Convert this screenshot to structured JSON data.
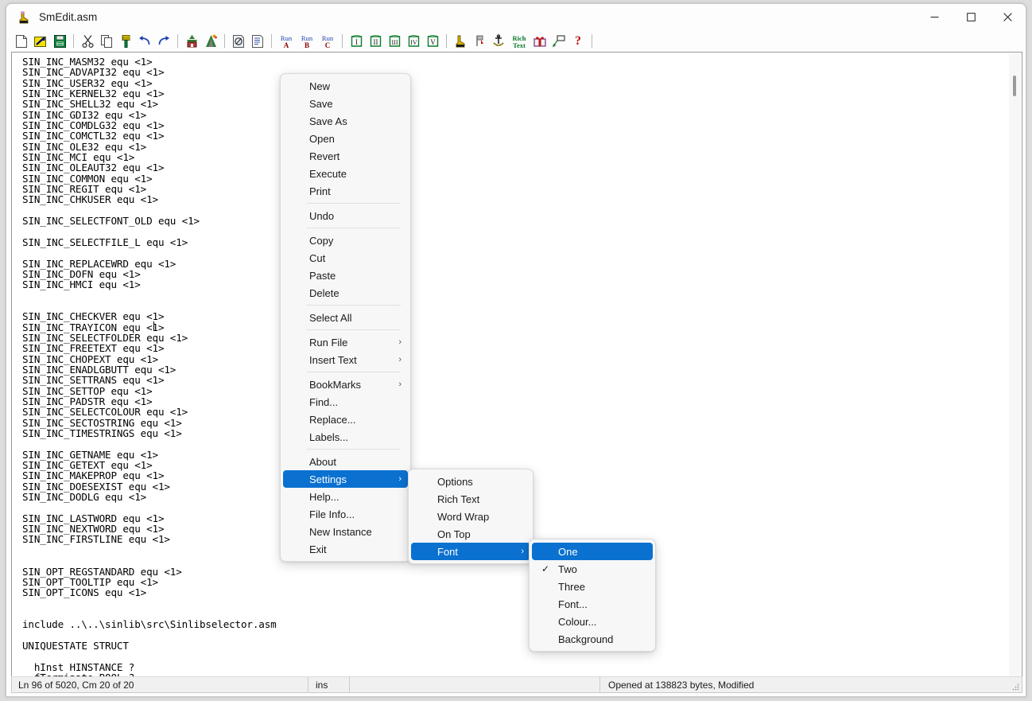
{
  "window": {
    "title": "SmEdit.asm",
    "icon": "boot-icon",
    "controls": {
      "minimize": "–",
      "maximize": "☐",
      "close": "×"
    }
  },
  "toolbar": {
    "groups": [
      [
        {
          "name": "new-file-icon",
          "label": "New"
        },
        {
          "name": "open-file-icon",
          "label": "Open"
        },
        {
          "name": "save-file-icon",
          "label": "Save"
        }
      ],
      [
        {
          "name": "cut-icon",
          "label": "Cut"
        },
        {
          "name": "copy-icon",
          "label": "Copy"
        },
        {
          "name": "paste-icon",
          "label": "Paste"
        },
        {
          "name": "undo-icon",
          "label": "Undo"
        },
        {
          "name": "redo-icon",
          "label": "Redo"
        }
      ],
      [
        {
          "name": "build-icon",
          "label": "Build"
        },
        {
          "name": "assemble-icon",
          "label": "Assemble"
        }
      ],
      [
        {
          "name": "preview-icon",
          "label": "Preview"
        },
        {
          "name": "document-icon",
          "label": "Document"
        }
      ],
      [
        {
          "name": "run-a-icon",
          "label": "Run A"
        },
        {
          "name": "run-b-icon",
          "label": "Run B"
        },
        {
          "name": "run-c-icon",
          "label": "Run C"
        }
      ],
      [
        {
          "name": "bookmark-1-icon",
          "label": "Bookmark I"
        },
        {
          "name": "bookmark-2-icon",
          "label": "Bookmark II"
        },
        {
          "name": "bookmark-3-icon",
          "label": "Bookmark III"
        },
        {
          "name": "bookmark-4-icon",
          "label": "Bookmark IV"
        },
        {
          "name": "bookmark-5-icon",
          "label": "Bookmark V"
        }
      ],
      [
        {
          "name": "boot-icon",
          "label": "Boot"
        },
        {
          "name": "flag-icon",
          "label": "Flag"
        },
        {
          "name": "anchor-icon",
          "label": "Anchor"
        },
        {
          "name": "rich-text-icon",
          "label": "Rich Text"
        },
        {
          "name": "gift-icon",
          "label": "Gift"
        },
        {
          "name": "select-icon",
          "label": "Select"
        },
        {
          "name": "help-icon",
          "label": "Help"
        }
      ]
    ]
  },
  "editor": {
    "content": "SIN_INC_MASM32 equ <1>\nSIN_INC_ADVAPI32 equ <1>\nSIN_INC_USER32 equ <1>\nSIN_INC_KERNEL32 equ <1>\nSIN_INC_SHELL32 equ <1>\nSIN_INC_GDI32 equ <1>\nSIN_INC_COMDLG32 equ <1>\nSIN_INC_COMCTL32 equ <1>\nSIN_INC_OLE32 equ <1>\nSIN_INC_MCI equ <1>\nSIN_INC_OLEAUT32 equ <1>\nSIN_INC_COMMON equ <1>\nSIN_INC_REGIT equ <1>\nSIN_INC_CHKUSER equ <1>\n\nSIN_INC_SELECTFONT_OLD equ <1>\n\nSIN_INC_SELECTFILE_L equ <1>\n\nSIN_INC_REPLACEWRD equ <1>\nSIN_INC_DOFN equ <1>\nSIN_INC_HMCI equ <1>\n\n\nSIN_INC_CHECKVER equ <1>\nSIN_INC_TRAYICON equ <1>\nSIN_INC_SELECTFOLDER equ <1>\nSIN_INC_FREETEXT equ <1>\nSIN_INC_CHOPEXT equ <1>\nSIN_INC_ENADLGBUTT equ <1>\nSIN_INC_SETTRANS equ <1>\nSIN_INC_SETTOP equ <1>\nSIN_INC_PADSTR equ <1>\nSIN_INC_SELECTCOLOUR equ <1>\nSIN_INC_SECTOSTRING equ <1>\nSIN_INC_TIMESTRINGS equ <1>\n\nSIN_INC_GETNAME equ <1>\nSIN_INC_GETEXT equ <1>\nSIN_INC_MAKEPROP equ <1>\nSIN_INC_DOESEXIST equ <1>\nSIN_INC_DODLG equ <1>\n\nSIN_INC_LASTWORD equ <1>\nSIN_INC_NEXTWORD equ <1>\nSIN_INC_FIRSTLINE equ <1>\n\n\nSIN_OPT_REGSTANDARD equ <1>\nSIN_OPT_TOOLTIP equ <1>\nSIN_OPT_ICONS equ <1>\n\n\ninclude ..\\..\\sinlib\\src\\Sinlibselector.asm\n\nUNIQUESTATE STRUCT\n\n  hInst HINSTANCE ?\n  fTerminate BOOL ?\n  dTextRet DWORD ?"
  },
  "statusbar": {
    "position": "Ln 96 of 5020, Cm 20 of 20",
    "insert_mode": "ins",
    "spacer": "",
    "file_info": "Opened at 138823 bytes, Modified"
  },
  "menus": {
    "main": {
      "items": [
        {
          "label": "New",
          "type": "item"
        },
        {
          "label": "Save",
          "type": "item"
        },
        {
          "label": "Save As",
          "type": "item"
        },
        {
          "label": "Open",
          "type": "item"
        },
        {
          "label": "Revert",
          "type": "item"
        },
        {
          "label": "Execute",
          "type": "item"
        },
        {
          "label": "Print",
          "type": "item"
        },
        {
          "type": "separator"
        },
        {
          "label": "Undo",
          "type": "item"
        },
        {
          "type": "separator"
        },
        {
          "label": "Copy",
          "type": "item"
        },
        {
          "label": "Cut",
          "type": "item"
        },
        {
          "label": "Paste",
          "type": "item"
        },
        {
          "label": "Delete",
          "type": "item"
        },
        {
          "type": "separator"
        },
        {
          "label": "Select All",
          "type": "item"
        },
        {
          "type": "separator"
        },
        {
          "label": "Run File",
          "type": "item",
          "submenu": true
        },
        {
          "label": "Insert Text",
          "type": "item",
          "submenu": true
        },
        {
          "type": "separator"
        },
        {
          "label": "BookMarks",
          "type": "item",
          "submenu": true
        },
        {
          "label": "Find...",
          "type": "item"
        },
        {
          "label": "Replace...",
          "type": "item"
        },
        {
          "label": "Labels...",
          "type": "item"
        },
        {
          "type": "separator"
        },
        {
          "label": "About",
          "type": "item"
        },
        {
          "label": "Settings",
          "type": "item",
          "submenu": true,
          "selected": true
        },
        {
          "label": "Help...",
          "type": "item"
        },
        {
          "label": "File Info...",
          "type": "item"
        },
        {
          "label": "New Instance",
          "type": "item"
        },
        {
          "label": "Exit",
          "type": "item"
        }
      ]
    },
    "settings": {
      "items": [
        {
          "label": "Options",
          "type": "item"
        },
        {
          "label": "Rich Text",
          "type": "item"
        },
        {
          "label": "Word Wrap",
          "type": "item"
        },
        {
          "label": "On Top",
          "type": "item"
        },
        {
          "label": "Font",
          "type": "item",
          "submenu": true,
          "selected": true
        }
      ]
    },
    "font": {
      "items": [
        {
          "label": "One",
          "type": "item",
          "selected": true
        },
        {
          "label": "Two",
          "type": "item",
          "checked": true
        },
        {
          "label": "Three",
          "type": "item"
        },
        {
          "label": "Font...",
          "type": "item"
        },
        {
          "label": "Colour...",
          "type": "item"
        },
        {
          "label": "Background",
          "type": "item"
        }
      ]
    }
  },
  "colors": {
    "accent": "#0b71d0",
    "menu_bg": "#f7f7f7",
    "window_bg": "#fdfdfd",
    "editor_bg": "#ffffff",
    "status_bg": "#f0f0f0"
  },
  "glyphs": {
    "submenu_arrow": "›",
    "check": "✓"
  }
}
